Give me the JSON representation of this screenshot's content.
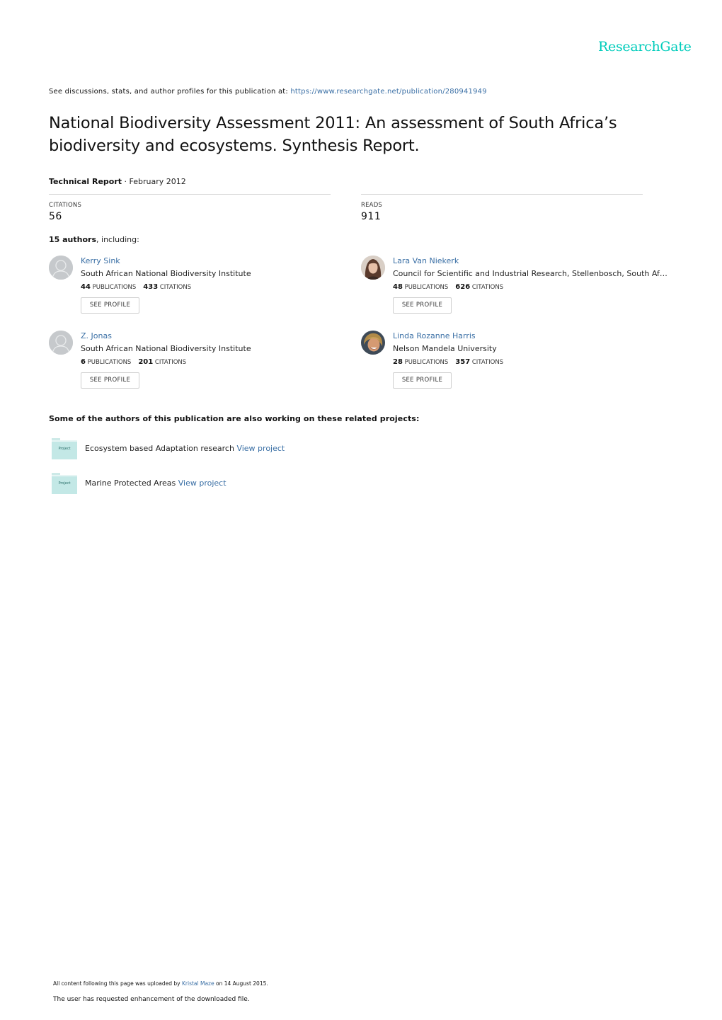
{
  "header": {
    "logo": "ResearchGate",
    "see_text": "See discussions, stats, and author profiles for this publication at: ",
    "publication_url": "https://www.researchgate.net/publication/280941949"
  },
  "publication": {
    "title": "National Biodiversity Assessment 2011: An assessment of South Africa’s biodiversity and ecosystems. Synthesis Report.",
    "type": "Technical Report",
    "date_separator": " · ",
    "date": "February 2012"
  },
  "stats": {
    "citations_label": "CITATIONS",
    "citations_value": "56",
    "reads_label": "READS",
    "reads_value": "911"
  },
  "authors_summary": {
    "count": "15 authors",
    "suffix": ", including:"
  },
  "authors": [
    {
      "name": "Kerry Sink",
      "institution": "South African National Biodiversity Institute",
      "publications": "44",
      "citations": "433",
      "avatar": "default-avatar"
    },
    {
      "name": "Lara Van Niekerk",
      "institution": "Council for Scientific and Industrial Research, Stellenbosch, South Af…",
      "publications": "48",
      "citations": "626",
      "avatar": "photo"
    },
    {
      "name": "Z. Jonas",
      "institution": "South African National Biodiversity Institute",
      "publications": "6",
      "citations": "201",
      "avatar": "default-avatar"
    },
    {
      "name": "Linda Rozanne Harris",
      "institution": "Nelson Mandela University",
      "publications": "28",
      "citations": "357",
      "avatar": "photo"
    }
  ],
  "author_labels": {
    "publications": "PUBLICATIONS",
    "citations": "CITATIONS",
    "see_profile": "SEE PROFILE"
  },
  "related": {
    "heading": "Some of the authors of this publication are also working on these related projects:",
    "folder_label": "Project",
    "view_label": "View project",
    "projects": [
      {
        "name": "Ecosystem based Adaptation research"
      },
      {
        "name": "Marine Protected Areas"
      }
    ]
  },
  "footer": {
    "uploaded_prefix": "All content following this page was uploaded by ",
    "uploader": "Kristal Maze",
    "uploaded_suffix": " on 14 August 2015.",
    "enhancement_note": "The user has requested enhancement of the downloaded file."
  },
  "colors": {
    "brand": "#00ccbb",
    "link": "#3a6fa5",
    "folder": "#c3e8e6"
  }
}
